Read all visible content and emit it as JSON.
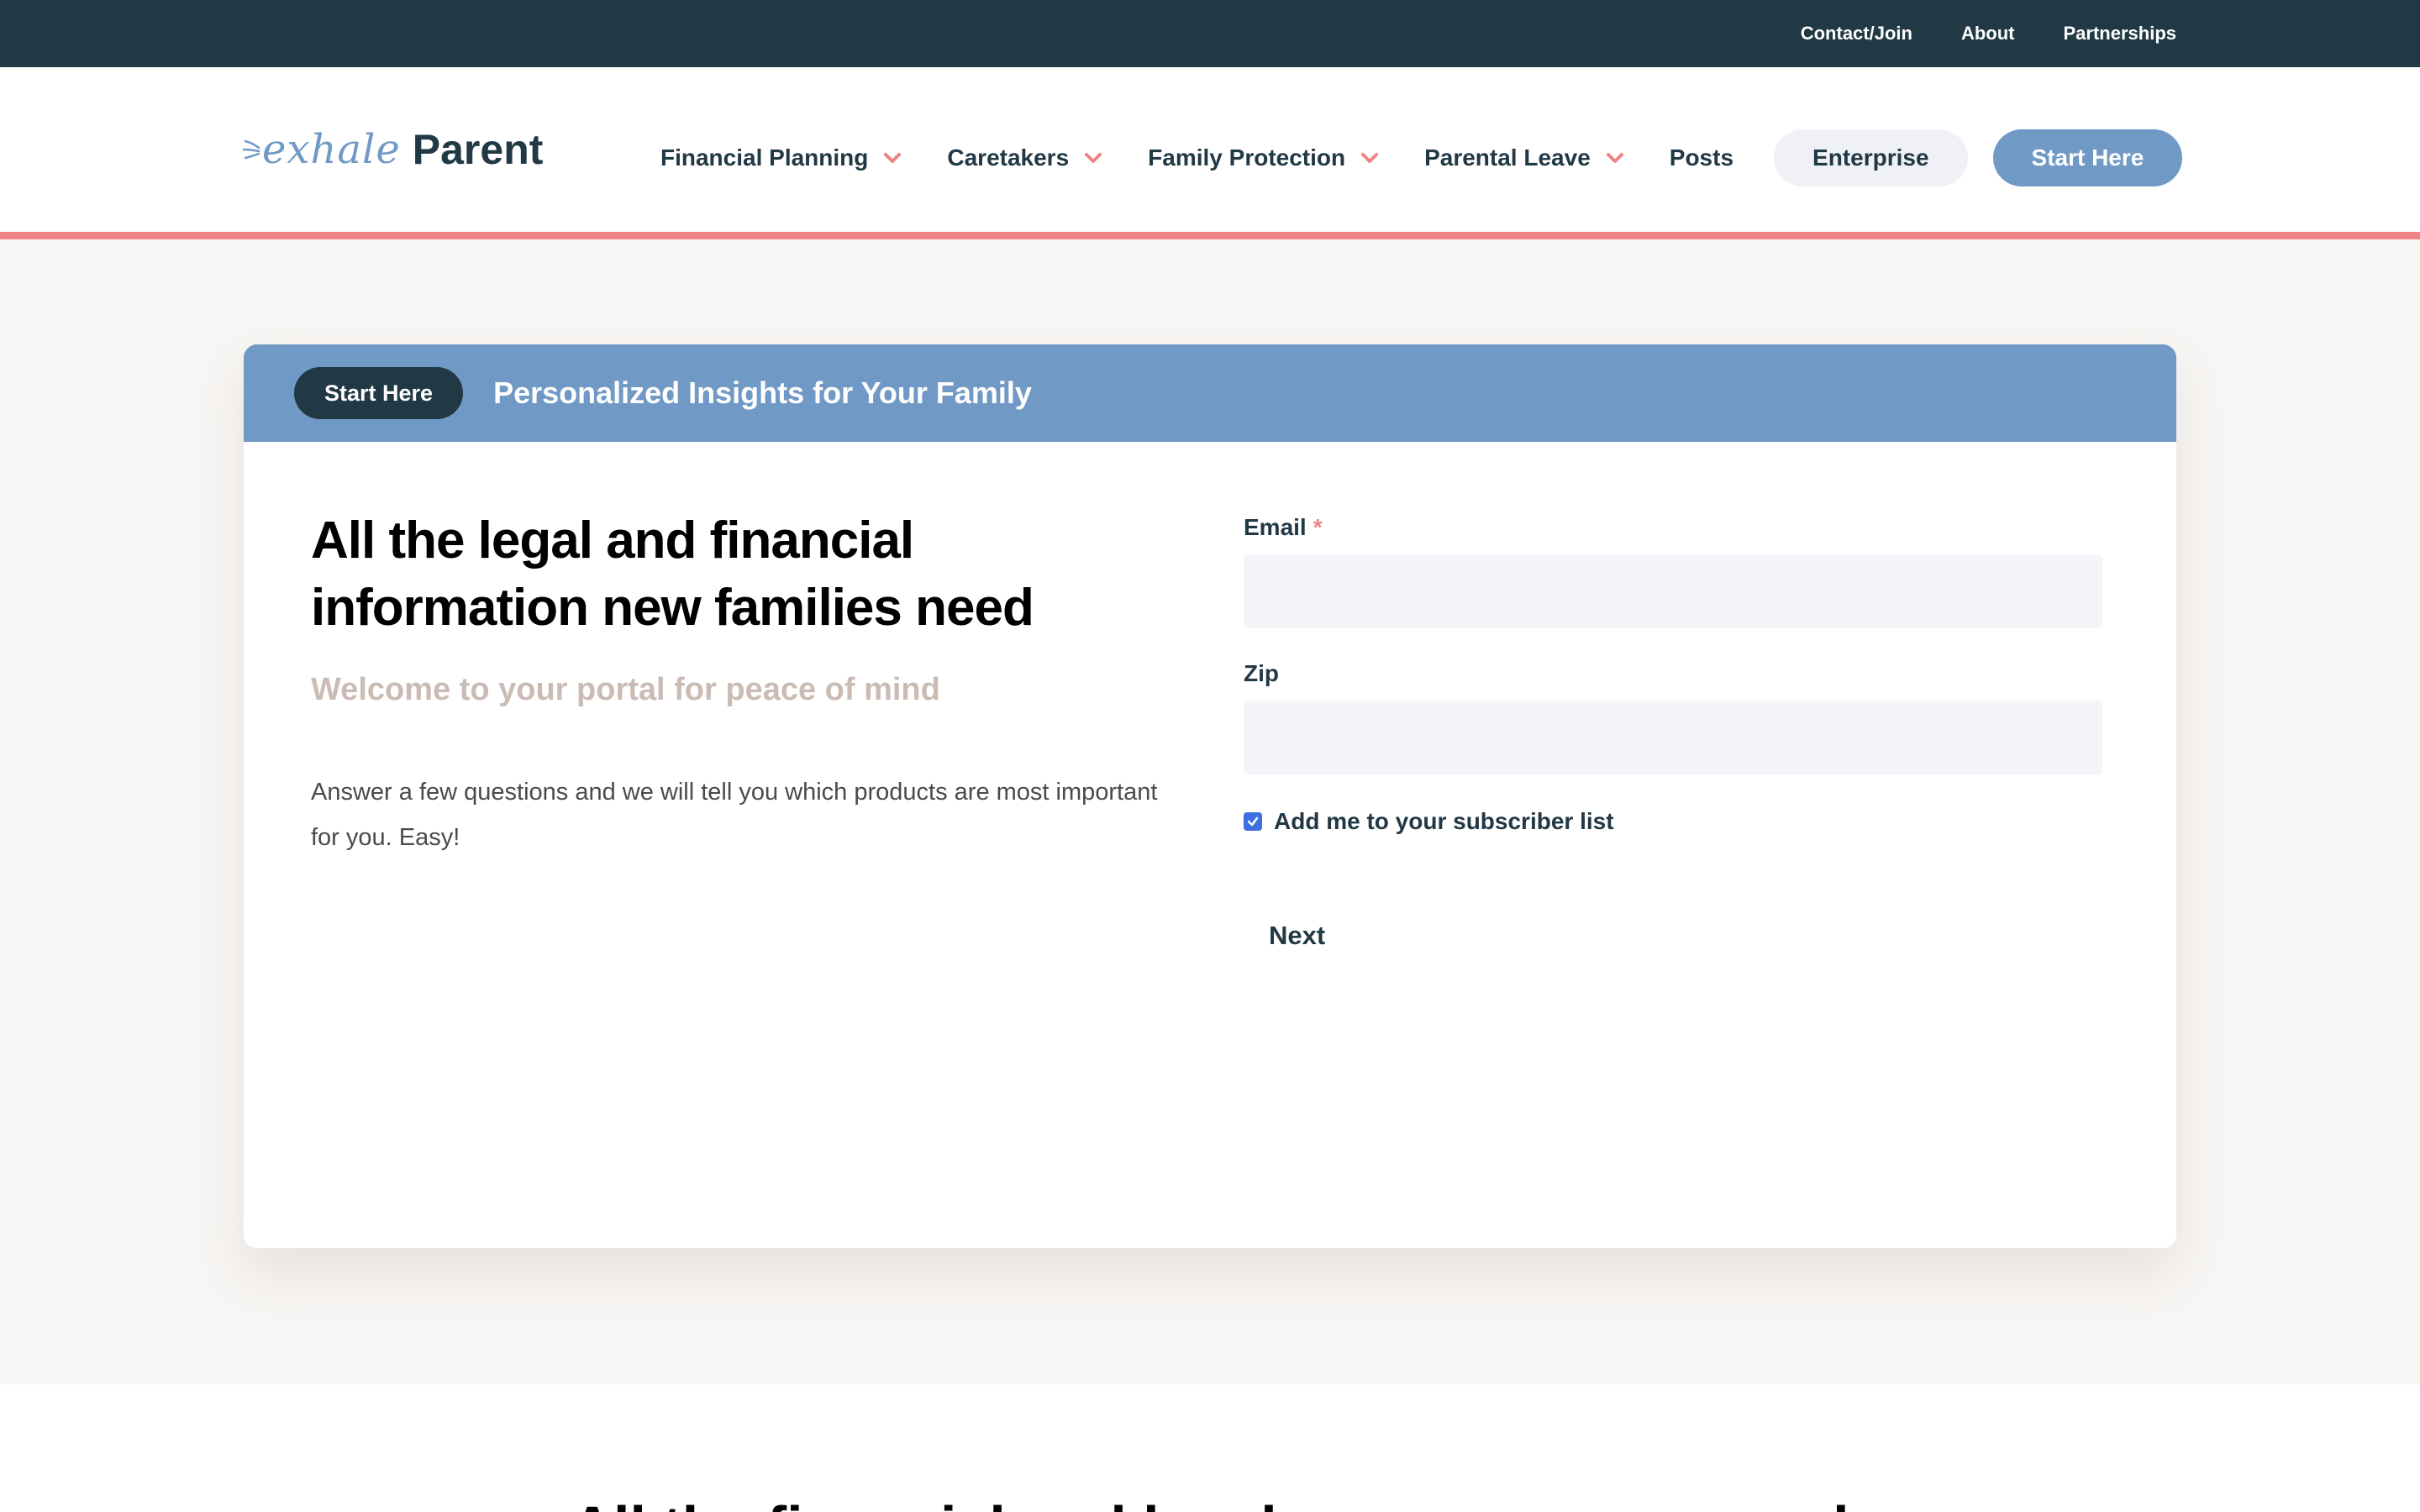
{
  "topbar": {
    "links": [
      "Contact/Join",
      "About",
      "Partnerships"
    ]
  },
  "logo": {
    "script_text": "exhale",
    "word_text": "Parent"
  },
  "nav": {
    "items": [
      {
        "label": "Financial Planning",
        "has_dropdown": true
      },
      {
        "label": "Caretakers",
        "has_dropdown": true
      },
      {
        "label": "Family Protection",
        "has_dropdown": true
      },
      {
        "label": "Parental Leave",
        "has_dropdown": true
      },
      {
        "label": "Posts",
        "has_dropdown": false
      }
    ],
    "enterprise_label": "Enterprise",
    "start_label": "Start Here"
  },
  "card": {
    "badge": "Start Here",
    "title": "Personalized Insights for Your Family",
    "headline": "All the legal and financial information new families need",
    "subhead": "Welcome to your portal for peace of mind",
    "intro": "Answer a few questions and we will tell you which products are most important for you. Easy!"
  },
  "form": {
    "email_label": "Email",
    "required_mark": "*",
    "email_value": "",
    "zip_label": "Zip",
    "zip_value": "",
    "subscribe_label": "Add me to your subscriber list",
    "subscribe_checked": true,
    "next_label": "Next"
  },
  "next_section": {
    "heading": "All the financial and legal resources you need"
  },
  "colors": {
    "topbar": "#213845",
    "accent_coral": "#f08384",
    "brand_blue": "#7199c6",
    "hero_bg": "#f8f6f4",
    "checkbox_blue": "#3e6fe0"
  }
}
